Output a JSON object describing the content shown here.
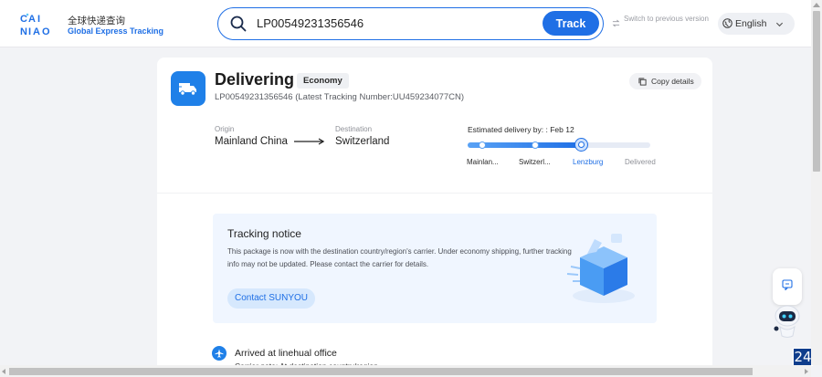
{
  "header": {
    "logo_text_cn": "全球快递查询",
    "logo_text_en": "Global Express Tracking",
    "search": {
      "value": "LP00549231356546",
      "placeholder": "",
      "button_label": "Track"
    },
    "switch_version": "Switch to previous version",
    "language": "English"
  },
  "shipment": {
    "status": "Delivering",
    "service_badge": "Economy",
    "tracking_line": "LP00549231356546  (Latest Tracking Number:UU459234077CN)",
    "copy_label": "Copy details",
    "origin_label": "Origin",
    "origin": "Mainland China",
    "destination_label": "Destination",
    "destination": "Switzerland",
    "estimated_label": "Estimated delivery by: :  Feb 12",
    "progress_fraction": 0.62,
    "steps": [
      "Mainlan...",
      "Switzerl...",
      "Lenzburg",
      "Delivered"
    ],
    "current_step_index": 2
  },
  "notice": {
    "title": "Tracking notice",
    "text": "This package is now with the destination country/region's carrier. Under economy shipping, further tracking info may not be updated. Please contact the carrier for details.",
    "contact_label": "Contact SUNYOU"
  },
  "event": {
    "title": "Arrived at linehual office",
    "note": "Carrier note: At destination country/region"
  },
  "corner_badge": "24",
  "colors": {
    "accent": "#1f6fe5",
    "notice_bg": "#f0f6ff",
    "page_bg": "#f2f3f6"
  }
}
